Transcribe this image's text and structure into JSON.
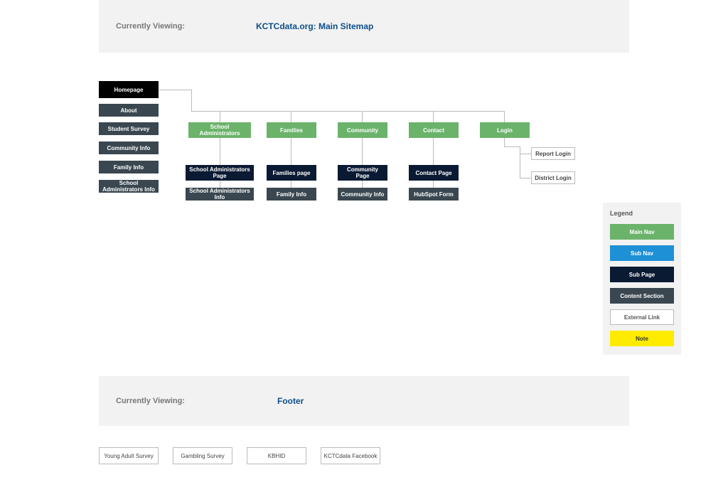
{
  "header": {
    "label": "Currently Viewing:",
    "title": "KCTCdata.org: Main Sitemap"
  },
  "sidebar": {
    "homepage": "Homepage",
    "items": [
      "About",
      "Student Survey",
      "Community Info",
      "Family Info",
      "School Administrators Info"
    ]
  },
  "mainnav": [
    "School Administrators",
    "Families",
    "Community",
    "Contact",
    "Login"
  ],
  "subpages": [
    "School Administrators Page",
    "Families page",
    "Community Page",
    "Contact Page"
  ],
  "content_sections": [
    "School Administrators Info",
    "Family Info",
    "Community Info",
    "HubSpot Form"
  ],
  "login_links": [
    "Report Login",
    "District Login"
  ],
  "legend": {
    "title": "Legend",
    "items": [
      "Main Nav",
      "Sub Nav",
      "Sub Page",
      "Content Section",
      "External Link",
      "Note"
    ]
  },
  "footer_header": {
    "label": "Currently Viewing:",
    "title": "Footer"
  },
  "footer_links": [
    "Young Adult Survey",
    "Gambling Survey",
    "KBHID",
    "KCTCdata Facebook"
  ]
}
